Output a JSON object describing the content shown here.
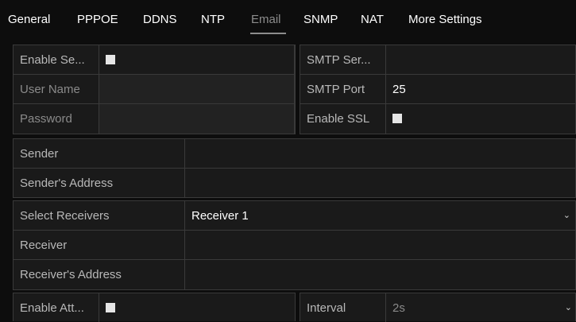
{
  "tabs": [
    {
      "label": "General"
    },
    {
      "label": "PPPOE"
    },
    {
      "label": "DDNS"
    },
    {
      "label": "NTP"
    },
    {
      "label": "Email",
      "active": true
    },
    {
      "label": "SNMP"
    },
    {
      "label": "NAT"
    },
    {
      "label": "More Settings"
    }
  ],
  "server": {
    "enable_server_label": "Enable Se...",
    "user_name_label": "User Name",
    "password_label": "Password",
    "smtp_server_label": "SMTP Ser...",
    "smtp_port_label": "SMTP Port",
    "smtp_port_value": "25",
    "enable_ssl_label": "Enable SSL"
  },
  "sender": {
    "sender_label": "Sender",
    "sender_address_label": "Sender's Address"
  },
  "receivers": {
    "select_receivers_label": "Select Receivers",
    "select_receivers_value": "Receiver 1",
    "receiver_label": "Receiver",
    "receiver_address_label": "Receiver's Address"
  },
  "attachment": {
    "enable_attach_label": "Enable Att...",
    "interval_label": "Interval",
    "interval_value": "2s"
  },
  "colors": {
    "background": "#0d0d0d",
    "panel": "#1a1a1a",
    "border": "#3a3a3a",
    "active_tab": "#8c8c8c"
  }
}
